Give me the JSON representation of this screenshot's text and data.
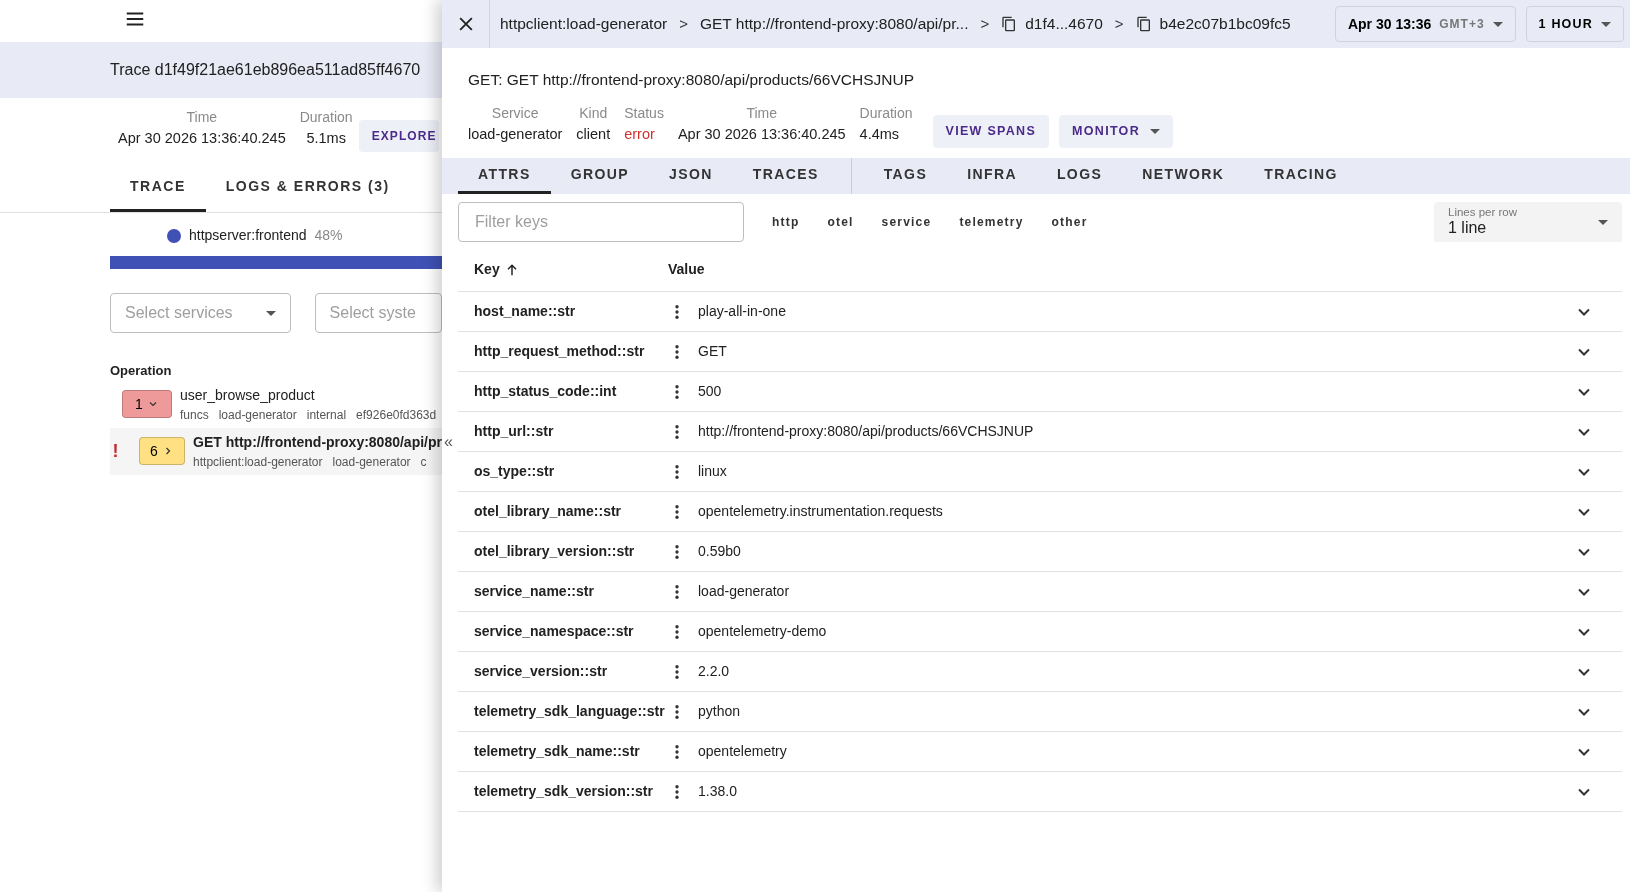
{
  "left": {
    "trace_title": "Trace d1f49f21ae61eb896ea511ad85ff4670",
    "stats": [
      {
        "label": "Time",
        "value": "Apr 30 2026 13:36:40.245"
      },
      {
        "label": "Duration",
        "value": "5.1ms"
      }
    ],
    "explore_button": "EXPLORE",
    "error_symbol": "!",
    "tabs": [
      {
        "label": "TRACE",
        "selected": true
      },
      {
        "label": "LOGS & ERRORS (3)",
        "selected": false
      }
    ],
    "legend": {
      "name": "httpserver:frontend",
      "percent": "48%",
      "color": "#3f51b5"
    },
    "filters": [
      {
        "placeholder": "Select services"
      },
      {
        "placeholder": "Select syste"
      }
    ],
    "operation_heading": "Operation",
    "spans": [
      {
        "badge": "1",
        "expanded": true,
        "error": false,
        "color": "#ef9a9a",
        "name": "user_browse_product",
        "details": [
          "funcs",
          "load-generator",
          "internal",
          "ef926e0fd363d"
        ]
      },
      {
        "badge": "6",
        "expanded": false,
        "error": true,
        "color": "#ffe082",
        "name": "GET http://frontend-proxy:8080/api/pr",
        "details": [
          "httpclient:load-generator",
          "load-generator",
          "c"
        ]
      }
    ]
  },
  "drawer": {
    "collapse_handle": "«",
    "breadcrumb_separator": ">",
    "breadcrumbs": [
      {
        "text": "httpclient:load-generator",
        "copy": false
      },
      {
        "text": "GET http://frontend-proxy:8080/api/pr...",
        "copy": false
      },
      {
        "text": "d1f4...4670",
        "copy": true
      },
      {
        "text": "b4e2c07b1bc09fc5",
        "copy": true
      }
    ],
    "time_picker": {
      "value": "Apr 30 13:36",
      "zone": "GMT+3"
    },
    "range_button": "1 HOUR",
    "title": "GET: GET http://frontend-proxy:8080/api/products/66VCHSJNUP",
    "stats": [
      {
        "label": "Service",
        "value": "load-generator",
        "kind": "normal"
      },
      {
        "label": "Kind",
        "value": "client",
        "kind": "normal"
      },
      {
        "label": "Status",
        "value": "error",
        "kind": "error"
      },
      {
        "label": "Time",
        "value": "Apr 30 2026 13:36:40.245",
        "kind": "normal"
      },
      {
        "label": "Duration",
        "value": "4.4ms",
        "kind": "normal"
      }
    ],
    "actions": [
      {
        "label": "VIEW SPANS",
        "dropdown": false
      },
      {
        "label": "MONITOR",
        "dropdown": true
      }
    ],
    "tab_groups": [
      [
        {
          "label": "ATTRS",
          "selected": true
        },
        {
          "label": "GROUP",
          "selected": false
        },
        {
          "label": "JSON",
          "selected": false
        },
        {
          "label": "TRACES",
          "selected": false
        }
      ],
      [
        {
          "label": "TAGS",
          "selected": false
        },
        {
          "label": "INFRA",
          "selected": false
        },
        {
          "label": "LOGS",
          "selected": false
        },
        {
          "label": "NETWORK",
          "selected": false
        },
        {
          "label": "TRACING",
          "selected": false
        }
      ]
    ],
    "filter": {
      "placeholder": "Filter keys"
    },
    "chips": [
      "http",
      "otel",
      "service",
      "telemetry",
      "other"
    ],
    "lines_per_row": {
      "label": "Lines per row",
      "value": "1 line"
    },
    "table": {
      "columns": [
        {
          "label": "Key",
          "sorted": true
        },
        {
          "label": "Value"
        }
      ],
      "rows": [
        {
          "key": "host_name::str",
          "value": "play-all-in-one",
          "expanded": false
        },
        {
          "key": "http_request_method::str",
          "value": "GET",
          "expanded": false
        },
        {
          "key": "http_status_code::int",
          "value": "500",
          "expanded": false
        },
        {
          "key": "http_url::str",
          "value": "http://frontend-proxy:8080/api/products/66VCHSJNUP",
          "expanded": false
        },
        {
          "key": "os_type::str",
          "value": "linux",
          "expanded": false
        },
        {
          "key": "otel_library_name::str",
          "value": "opentelemetry.instrumentation.requests",
          "expanded": false
        },
        {
          "key": "otel_library_version::str",
          "value": "0.59b0",
          "expanded": false
        },
        {
          "key": "service_name::str",
          "value": "load-generator",
          "expanded": false
        },
        {
          "key": "service_namespace::str",
          "value": "opentelemetry-demo",
          "expanded": false
        },
        {
          "key": "service_version::str",
          "value": "2.2.0",
          "expanded": false
        },
        {
          "key": "telemetry_sdk_language::str",
          "value": "python",
          "expanded": false
        },
        {
          "key": "telemetry_sdk_name::str",
          "value": "opentelemetry",
          "expanded": false
        },
        {
          "key": "telemetry_sdk_version::str",
          "value": "1.38.0",
          "expanded": false
        }
      ]
    }
  }
}
